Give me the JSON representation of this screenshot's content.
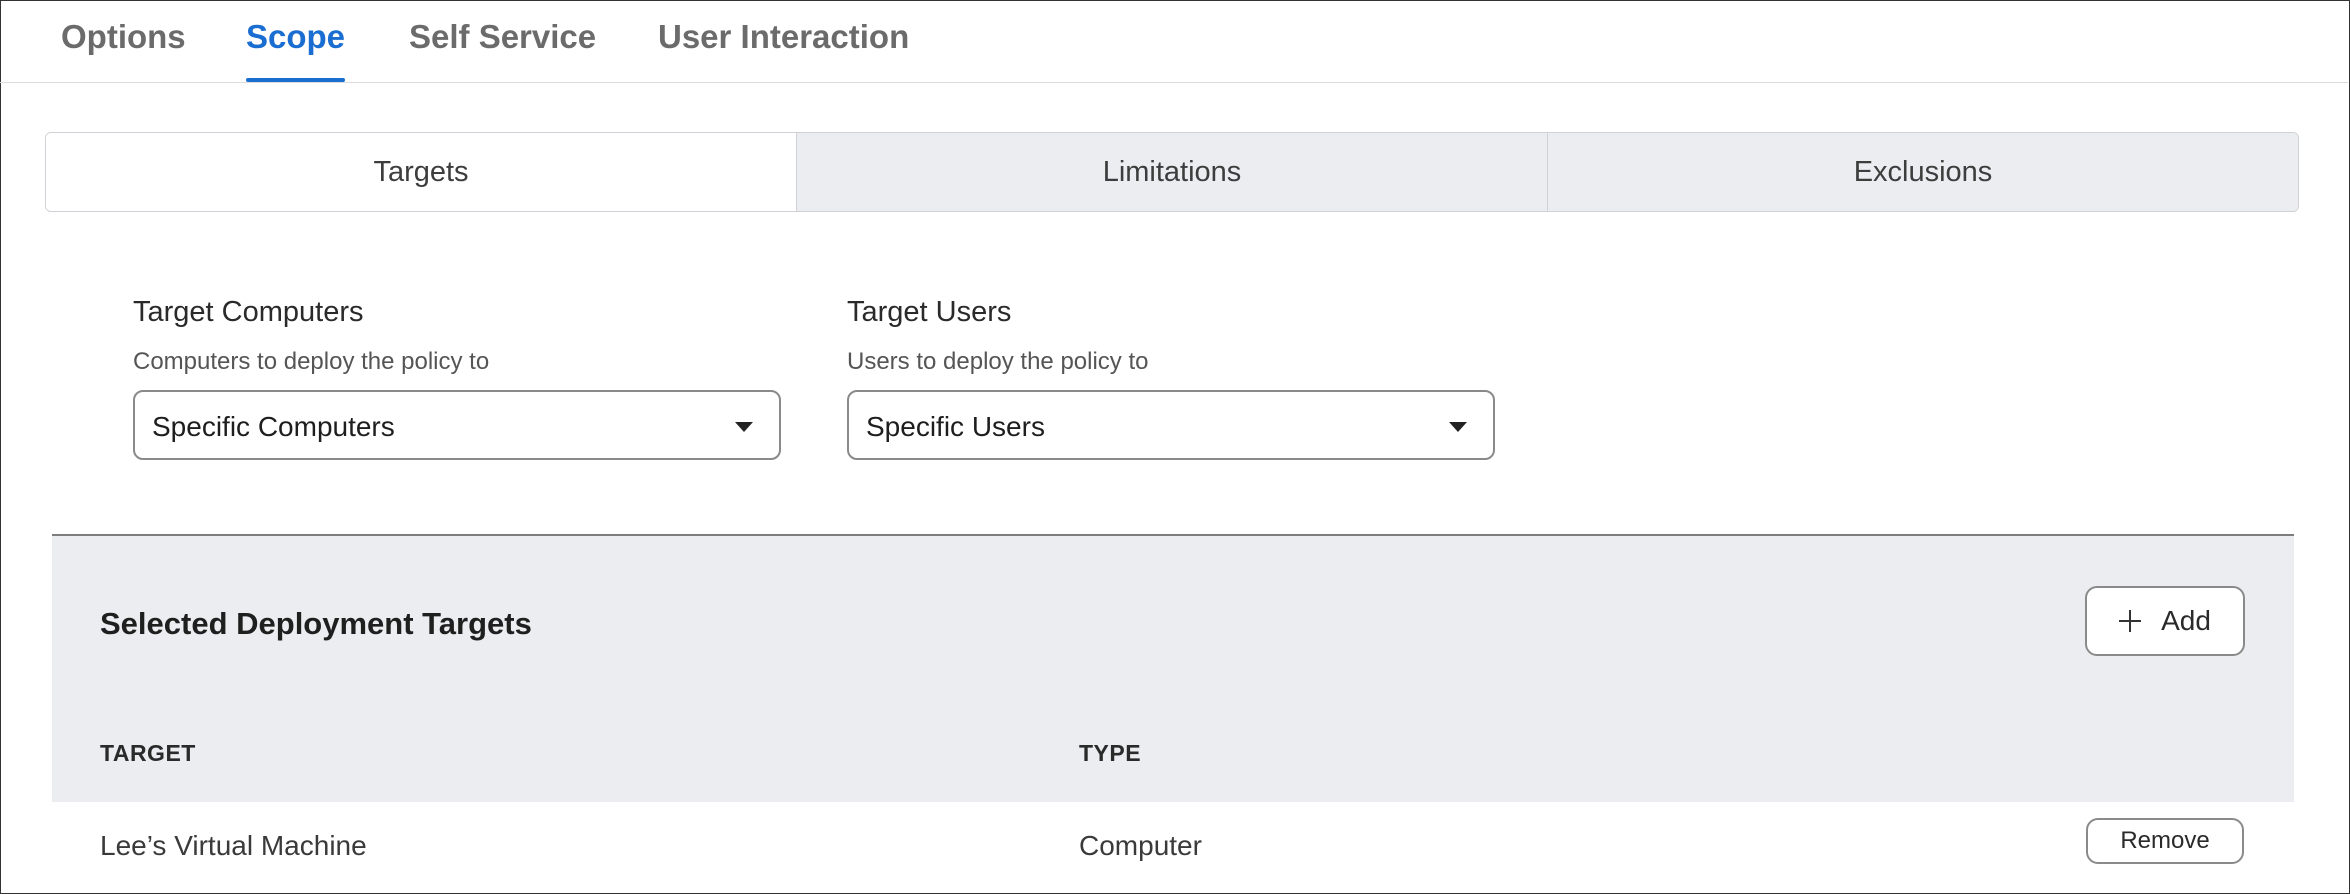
{
  "top_tabs": [
    {
      "label": "Options",
      "active": false
    },
    {
      "label": "Scope",
      "active": true
    },
    {
      "label": "Self Service",
      "active": false
    },
    {
      "label": "User Interaction",
      "active": false
    }
  ],
  "segments": [
    {
      "label": "Targets",
      "selected": true
    },
    {
      "label": "Limitations",
      "selected": false
    },
    {
      "label": "Exclusions",
      "selected": false
    }
  ],
  "target_computers": {
    "label": "Target Computers",
    "help": "Computers to deploy the policy to",
    "value": "Specific Computers"
  },
  "target_users": {
    "label": "Target Users",
    "help": "Users to deploy the policy to",
    "value": "Specific Users"
  },
  "targets_panel": {
    "title": "Selected Deployment Targets",
    "add_label": "Add",
    "columns": [
      "TARGET",
      "TYPE"
    ],
    "rows": [
      {
        "target": "Lee’s Virtual Machine",
        "type": "Computer",
        "action": "Remove"
      }
    ]
  },
  "colors": {
    "accent": "#1a6ed1",
    "panel_bg": "#ecedf0"
  }
}
